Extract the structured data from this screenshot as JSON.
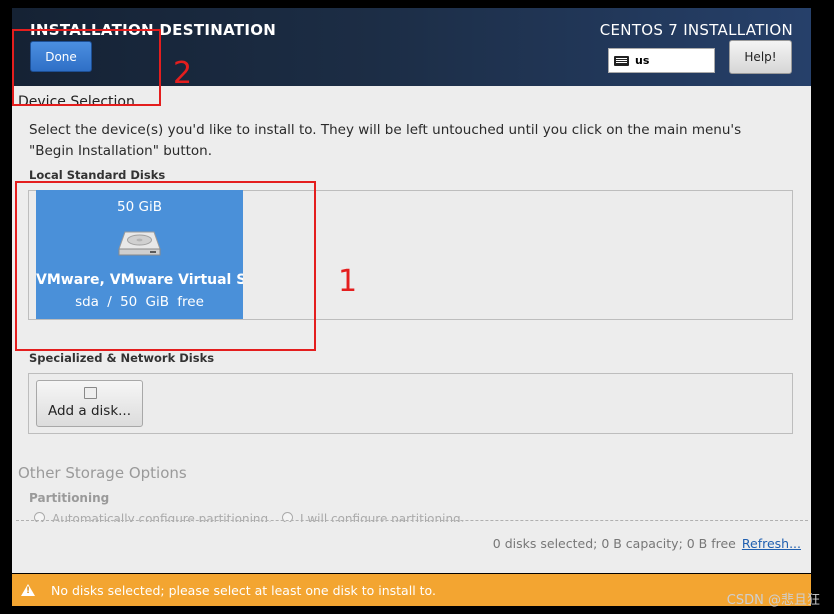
{
  "header": {
    "spoke_title": "INSTALLATION DESTINATION",
    "done_label": "Done",
    "product_title": "CENTOS 7 INSTALLATION",
    "keyboard_layout": "us",
    "help_label": "Help!"
  },
  "device_selection": {
    "heading": "Device Selection",
    "description_line1": "Select the device(s) you'd like to install to.  They will be left untouched until you click on the main menu's",
    "description_line2": "\"Begin Installation\" button."
  },
  "local_disks": {
    "heading": "Local Standard Disks",
    "disks": [
      {
        "size": "50 GiB",
        "name": "VMware, VMware Virtual S",
        "info": "sda   /   50 GiB free",
        "selected": true
      }
    ]
  },
  "network_disks": {
    "heading": "Specialized & Network Disks",
    "add_label": "Add a disk..."
  },
  "other_storage": {
    "heading": "Other Storage Options",
    "partitioning_heading": "Partitioning",
    "option_auto": "Automatically configure partitioning.",
    "option_manual": "I will configure partitioning."
  },
  "summary": {
    "text": "0 disks selected; 0 B capacity; 0 B free",
    "refresh_label": "Refresh..."
  },
  "warning": {
    "message": "No disks selected; please select at least one disk to install to."
  },
  "annotations": {
    "label_1": "1",
    "label_2": "2",
    "color": "#e41e1e"
  },
  "watermark": "CSDN @悲且狂",
  "colors": {
    "accent_blue": "#4a90d9",
    "warning_orange": "#f3a531"
  }
}
